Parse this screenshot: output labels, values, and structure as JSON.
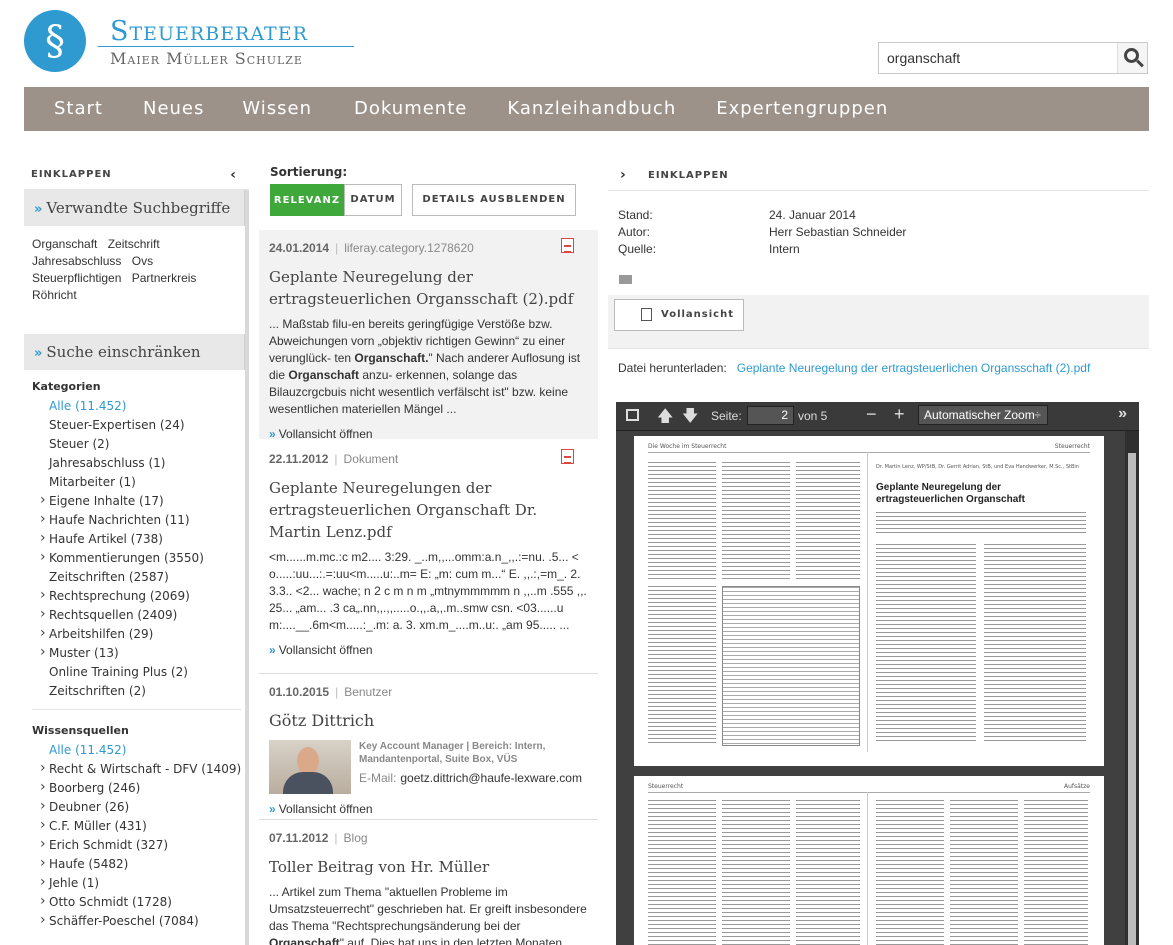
{
  "logo": {
    "symbol": "§",
    "title": "Steuerberater",
    "subtitle": "Maier Müller Schulze",
    "brand_color": "#2e9ad0"
  },
  "search": {
    "value": "organschaft",
    "button_icon": "search-icon"
  },
  "nav": {
    "items": [
      "Start",
      "Neues",
      "Wissen",
      "Dokumente",
      "Kanzleihandbuch",
      "Expertengruppen"
    ],
    "color": "#9c928a"
  },
  "sidebar": {
    "collapse_label": "EINKLAPPEN",
    "related_heading": "Verwandte Suchbegriffe",
    "related_terms": [
      "Organschaft",
      "Zeitschrift",
      "Jahresabschluss",
      "Ovs",
      "Steuerpflichtigen",
      "Partnerkreis",
      "Röhricht"
    ],
    "filter_heading": "Suche einschränken",
    "categories_title": "Kategorien",
    "categories": [
      {
        "label": "Alle (11.452)",
        "active": true,
        "sub": false
      },
      {
        "label": "Steuer-Expertisen (24)",
        "active": false,
        "sub": false
      },
      {
        "label": "Steuer (2)",
        "active": false,
        "sub": false
      },
      {
        "label": "Jahresabschluss (1)",
        "active": false,
        "sub": false
      },
      {
        "label": "Mitarbeiter (1)",
        "active": false,
        "sub": false
      },
      {
        "label": "Eigene Inhalte (17)",
        "active": false,
        "sub": true
      },
      {
        "label": "Haufe Nachrichten (11)",
        "active": false,
        "sub": true
      },
      {
        "label": "Haufe Artikel (738)",
        "active": false,
        "sub": true
      },
      {
        "label": "Kommentierungen (3550)",
        "active": false,
        "sub": true
      },
      {
        "label": "Zeitschriften (2587)",
        "active": false,
        "sub": false
      },
      {
        "label": "Rechtsprechung (2069)",
        "active": false,
        "sub": true
      },
      {
        "label": "Rechtsquellen (2409)",
        "active": false,
        "sub": true
      },
      {
        "label": "Arbeitshilfen (29)",
        "active": false,
        "sub": true
      },
      {
        "label": "Muster (13)",
        "active": false,
        "sub": true
      },
      {
        "label": "Online Training Plus (2)",
        "active": false,
        "sub": false
      },
      {
        "label": "Zeitschriften (2)",
        "active": false,
        "sub": false
      }
    ],
    "sources_title": "Wissensquellen",
    "sources": [
      {
        "label": "Alle (11.452)",
        "active": true,
        "sub": false
      },
      {
        "label": "Recht & Wirtschaft - DFV (1409)",
        "active": false,
        "sub": true
      },
      {
        "label": "Boorberg (246)",
        "active": false,
        "sub": true
      },
      {
        "label": "Deubner (26)",
        "active": false,
        "sub": true
      },
      {
        "label": "C.F. Müller (431)",
        "active": false,
        "sub": true
      },
      {
        "label": "Erich Schmidt (327)",
        "active": false,
        "sub": true
      },
      {
        "label": "Haufe (5482)",
        "active": false,
        "sub": true
      },
      {
        "label": "Jehle (1)",
        "active": false,
        "sub": true
      },
      {
        "label": "Otto Schmidt (1728)",
        "active": false,
        "sub": true
      },
      {
        "label": "Schäffer-Poeschel (7084)",
        "active": false,
        "sub": true
      }
    ]
  },
  "results": {
    "sort_label": "Sortierung:",
    "sort_relevance": "RELEVANZ",
    "sort_date": "DATUM",
    "details_toggle": "DETAILS AUSBLENDEN",
    "more_label": "Vollansicht öffnen",
    "items": [
      {
        "date": "24.01.2014",
        "type": "liferay.category.1278620",
        "title": "Geplante Neuregelung der ertragsteuerlichen Organsschaft (2).pdf",
        "snippet_pre": "... Maßstab filu-en bereits geringfügige Verstöße bzw. Abweichungen vorn „objektiv richtigen Gewinn“ zu einer verunglück- ten ",
        "snippet_hit": "Organschaft.",
        "snippet_mid": "\" Nach anderer Auflosung ist die ",
        "snippet_hit2": "Organschaft",
        "snippet_post": " anzu- erkennen, solange das Bilauzcrgcbuis nicht wesentlich verfälscht ist\" bzw. keine wesentlichen materiellen Mängel ..."
      },
      {
        "date": "22.11.2012",
        "type": "Dokument",
        "title": "Geplante Neuregelungen der ertragsteuerlichen Organschaft Dr. Martin Lenz.pdf",
        "snippet": "<m......m.mc.:c m2.... 3:29. _..m,,...omm:a.n_,,.:=nu. .5... <o.....:uu...:.=:uu<m.....u:..m= E: „m: cum m...“ E. ,,.:,=m_. 2.3.3.. <2... wache; n 2 c m n m „mtnymmmmm n ,,..m .555 ,,.25... „am... .3 ca„.nn,,.,,.....o.,,.a,,.m..smw csn. <03......um:....__.6m<m.....:_.m: a. 3. xm.m_....m..u:. „am 95..... ..."
      },
      {
        "date": "01.10.2015",
        "type": "Benutzer",
        "title": "Götz Dittrich",
        "role": "Key Account Manager | Bereich: Intern, Mandantenportal, Suite Box, VÜS",
        "email_label": "E-Mail:",
        "email": "goetz.dittrich@haufe-lexware.com"
      },
      {
        "date": "07.11.2012",
        "type": "Blog",
        "title": "Toller Beitrag von Hr. Müller",
        "snippet_pre": "... Artikel zum Thema \"aktuellen Probleme im Umsatzsteuerrecht\" geschrieben hat. Er greift insbesondere das Thema \"Rechtsprechungsänderung bei der ",
        "snippet_hit": "Organschaft",
        "snippet_post": "\" auf. Dies hat uns in den letzten Monaten ganz"
      }
    ]
  },
  "detail": {
    "collapse_label": "EINKLAPPEN",
    "stand_label": "Stand:",
    "stand_value": "24. Januar 2014",
    "author_label": "Autor:",
    "author_value": "Herr Sebastian Schneider",
    "source_label": "Quelle:",
    "source_value": "Intern",
    "full_view_label": "Vollansicht",
    "download_label": "Datei herunterladen:",
    "download_link": "Geplante Neuregelung der ertragsteuerlichen Organsschaft (2).pdf"
  },
  "viewer": {
    "page_label": "Seite:",
    "page_value": "2",
    "page_of": "von 5",
    "zoom_value": "Automatischer Zoom",
    "page1_header_left": "Die Woche im Steuerrecht",
    "page1_header_right": "Steuerrecht",
    "page1_authors": "Dr. Martin Lenz, WP/StB, Dr. Gerrit Adrian, StB, und Eva Handwerker, M.Sc., StBin",
    "page1_title": "Geplante Neuregelung der ertragsteuerlichen Organschaft",
    "page2_header_left": "Steuerrecht",
    "page2_header_right": "Aufsätze"
  }
}
